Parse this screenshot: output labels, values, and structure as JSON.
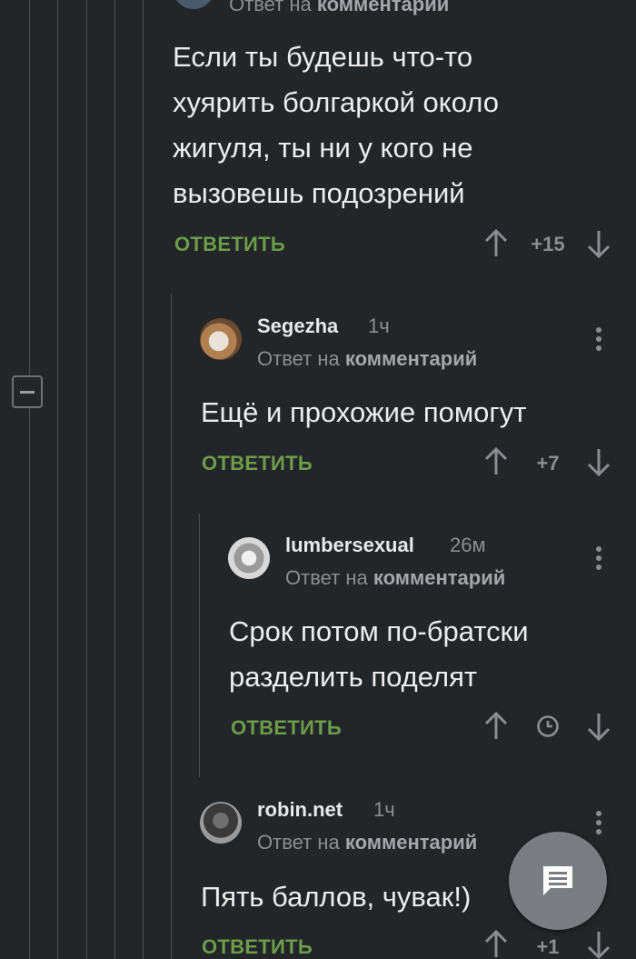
{
  "header_partial": {
    "reply_prefix": "Ответ на",
    "reply_target": "комментарий"
  },
  "comments": [
    {
      "text_lines": [
        "Если ты будешь что-то",
        "хуярить болгаркой около",
        "жигуля, ты ни у кого не",
        "вызовешь подозрений"
      ],
      "reply_label": "ОТВЕТИТЬ",
      "score": "+15"
    },
    {
      "author": "Segezha",
      "time": "1ч",
      "reply_prefix": "Ответ на",
      "reply_target": "комментарий",
      "text_lines": [
        "Ещё и прохожие помогут"
      ],
      "reply_label": "ОТВЕТИТЬ",
      "score": "+7"
    },
    {
      "author": "lumbersexual",
      "time": "26м",
      "reply_prefix": "Ответ на",
      "reply_target": "комментарий",
      "text_lines": [
        "Срок потом по-братски",
        "разделить поделят"
      ],
      "reply_label": "ОТВЕТИТЬ",
      "score_icon": "clock-icon"
    },
    {
      "author": "robin.net",
      "time": "1ч",
      "reply_prefix": "Ответ на",
      "reply_target": "комментарий",
      "text_lines": [
        "Пять баллов, чувак!)"
      ],
      "reply_label": "ОТВЕТИТЬ",
      "score": "+1"
    }
  ],
  "colors": {
    "background": "#232629",
    "reply_green": "#6d9c4b",
    "muted_gray": "#8a8d91",
    "fab": "#7a7d81"
  },
  "fab_icon": "comment-icon"
}
